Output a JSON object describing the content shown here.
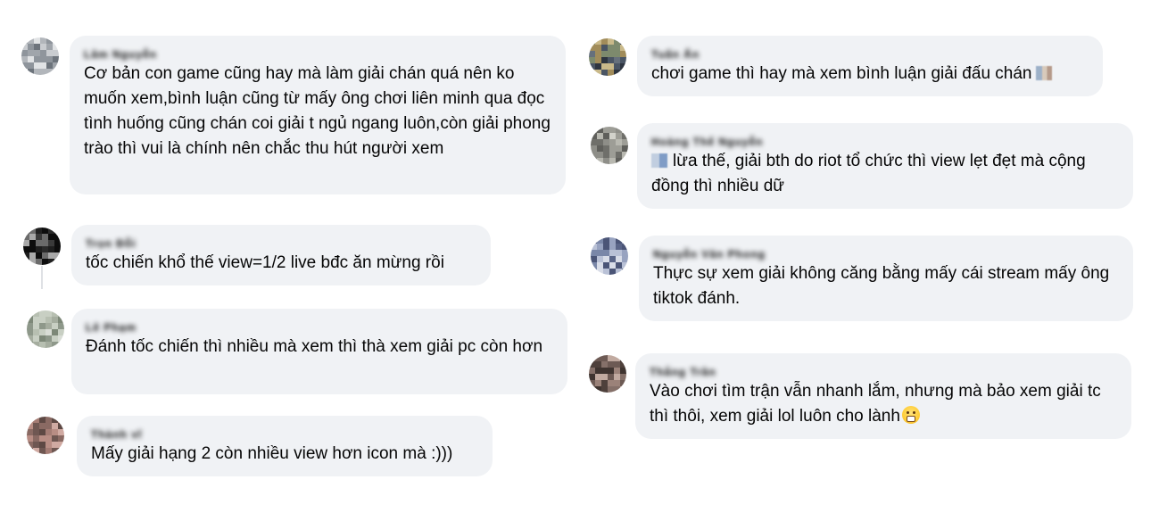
{
  "left_column": [
    {
      "author": "Lâm Nguyễn",
      "text": "Cơ bản con game cũng hay mà làm giải chán quá nên ko muốn xem,bình luận cũng từ mấy ông chơi liên minh qua đọc tình huống cũng chán coi giải t ngủ ngang luôn,còn giải phong trào thì vui là chính nên chắc thu hút người xem"
    },
    {
      "author": "Trọn Đỗi",
      "text": "tốc chiến khổ thế view=1/2 live bđc ăn mừng rồi"
    },
    {
      "author": "Lê Phạm",
      "text": "Đánh tốc chiến thì nhiều mà xem thì thà xem giải pc còn hơn"
    },
    {
      "author": "Thành vĩ",
      "text": "Mấy giải hạng 2 còn nhiều view hơn icon mà :)))"
    }
  ],
  "right_column": [
    {
      "author": "Tuấn Ấn",
      "text": "chơi game thì hay mà xem bình luận giải đấu chán",
      "trailing_emoji": "pixelated-emoji-icon"
    },
    {
      "author": "Hoàng Thế Nguyễn",
      "leading_emoji": "pixelated-emoji-icon",
      "text": "lừa thế, giải bth do riot tổ chức thì view lẹt đẹt mà cộng đồng thì nhiều dữ"
    },
    {
      "author": "Nguyễn Văn Phong",
      "text": "Thực sự xem giải không căng bằng mấy cái stream mấy ông tiktok đánh."
    },
    {
      "author": "Thắng Trần",
      "text": "Vào chơi tìm trận vẫn nhanh lắm, nhưng mà bảo xem giải tc thì thôi, xem giải lol luôn cho lành",
      "trailing_emoji": "grimacing-face-emoji-icon"
    }
  ],
  "colors": {
    "bubble_bg": "#f0f2f5",
    "text": "#050505",
    "thread_line": "#dfe1e5"
  }
}
